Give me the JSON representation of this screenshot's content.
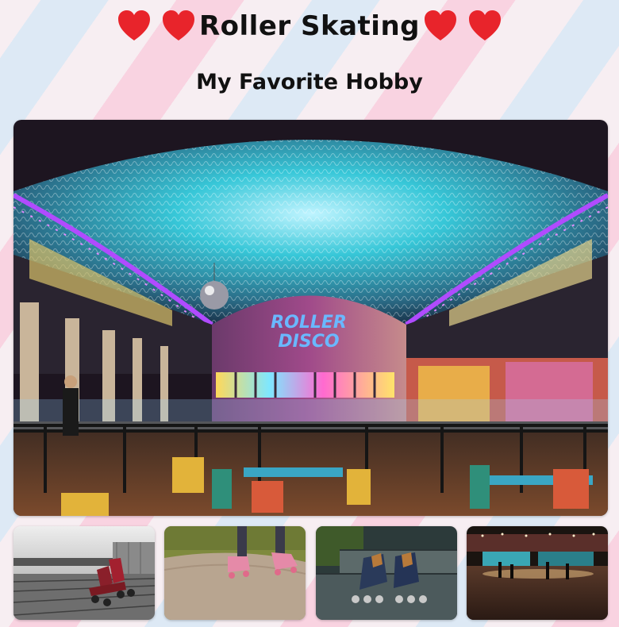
{
  "header": {
    "title": "Roller Skating",
    "subtitle": "My Favorite Hobby",
    "heart_icon": "heart-icon",
    "heart_color": "#e8242b"
  },
  "hero": {
    "sign_line1": "ROLLER",
    "sign_line2": "DISCO",
    "description": "Roller disco rink under a neon-lit arched ceiling"
  },
  "gallery": {
    "thumbnails": [
      {
        "subject": "Red quad skates on a wooden deck, black and white"
      },
      {
        "subject": "Skater legs with pink quad skates on a path"
      },
      {
        "subject": "Inline skates resting on stone steps"
      },
      {
        "subject": "Indoor roller rink with lights"
      }
    ]
  }
}
